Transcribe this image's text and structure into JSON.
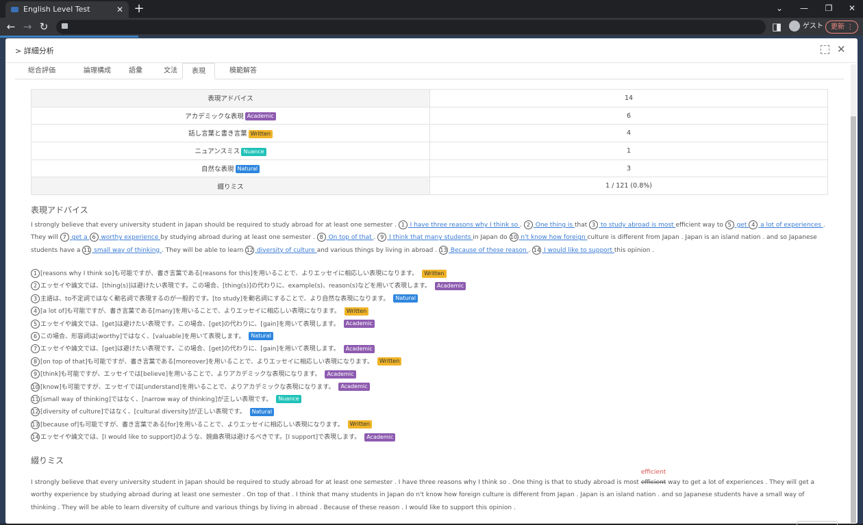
{
  "browser": {
    "tab_title": "English Level Test",
    "guest_label": "ゲスト",
    "update_label": "更新"
  },
  "modal": {
    "title": "詳細分析"
  },
  "tabs": [
    "総合評価",
    "論理構成",
    "語彙",
    "文法",
    "表現",
    "模範解答"
  ],
  "summary": [
    {
      "label": "表現アドバイス",
      "badge": "",
      "value": "14"
    },
    {
      "label": "アカデミックな表現",
      "badge": "Academic",
      "value": "6"
    },
    {
      "label": "話し言葉と書き言葉",
      "badge": "Written",
      "value": "4"
    },
    {
      "label": "ニュアンスミス",
      "badge": "Nuance",
      "value": "1"
    },
    {
      "label": "自然な表現",
      "badge": "Natural",
      "value": "3"
    },
    {
      "label": "綴りミス",
      "badge": "",
      "value": "1 / 121 (0.8%)"
    }
  ],
  "advice_heading": "表現アドバイス",
  "essay_segments": [
    {
      "t": "I strongly believe that every university student in Japan should be required to study abroad for at least one semester .  "
    },
    {
      "n": "1",
      "l": " I have three reasons why I think so "
    },
    {
      "t": " .  "
    },
    {
      "n": "2",
      "l": " One thing is "
    },
    {
      "t": "  that  "
    },
    {
      "n": "3",
      "l": " to study abroad is most "
    },
    {
      "t": "  efficient way to  "
    },
    {
      "n": "5",
      "l": " get "
    },
    {
      "t": " "
    },
    {
      "n": "4",
      "l": " a lot of experiences "
    },
    {
      "t": "  . They will  "
    },
    {
      "n": "7",
      "l": " get a "
    },
    {
      "t": " "
    },
    {
      "n": "6",
      "l": " worthy experience "
    },
    {
      "t": "  by studying abroad during at least one semester .  "
    },
    {
      "n": "8",
      "l": " On top of that "
    },
    {
      "t": " .  "
    },
    {
      "n": "9",
      "l": " I think that many students "
    },
    {
      "t": "  in Japan do  "
    },
    {
      "n": "10",
      "l": " n't know how foreign "
    },
    {
      "t": "  culture is different from Japan . Japan is an island nation . and so Japanese students have a  "
    },
    {
      "n": "11",
      "l": " small way of thinking "
    },
    {
      "t": "  . They will be able to learn  "
    },
    {
      "n": "12",
      "l": " diversity of culture "
    },
    {
      "t": "  and various things by living in abroad .  "
    },
    {
      "n": "13",
      "l": " Because of these reason "
    },
    {
      "t": " .  "
    },
    {
      "n": "14",
      "l": " I would like to support "
    },
    {
      "t": "  this opinion ."
    }
  ],
  "advice": [
    {
      "n": "1",
      "text": "[reasons why I think so]も可能ですが、書き言葉である[reasons for this]を用いることで、よりエッセイに相応しい表現になります。",
      "badge": "Written"
    },
    {
      "n": "2",
      "text": "エッセイや論文では、[thing(s)]は避けたい表現です。この場合、[thing(s)]の代わりに、example(s)、reason(s)などを用いて表現します。",
      "badge": "Academic"
    },
    {
      "n": "3",
      "text": "主語は、to不定詞ではなく動名詞で表現するのが一般的です。[to study]を動名詞にすることで、より自然な表現になります。",
      "badge": "Natural"
    },
    {
      "n": "4",
      "text": "[a lot of]も可能ですが、書き言葉である[many]を用いることで、よりエッセイに相応しい表現になります。",
      "badge": "Written"
    },
    {
      "n": "5",
      "text": "エッセイや論文では、[get]は避けたい表現です。この場合、[get]の代わりに、[gain]を用いて表現します。",
      "badge": "Academic"
    },
    {
      "n": "6",
      "text": "この場合、形容詞は[worthy]ではなく、[valuable]を用いて表現します。",
      "badge": "Natural"
    },
    {
      "n": "7",
      "text": "エッセイや論文では、[get]は避けたい表現です。この場合、[get]の代わりに、[gain]を用いて表現します。",
      "badge": "Academic"
    },
    {
      "n": "8",
      "text": "[on top of that]も可能ですが、書き言葉である[moreover]を用いることで、よりエッセイに相応しい表現になります。",
      "badge": "Written"
    },
    {
      "n": "9",
      "text": "[think]も可能ですが、エッセイでは[believe]を用いることで、よりアカデミックな表現になります。",
      "badge": "Academic"
    },
    {
      "n": "10",
      "text": "[know]も可能ですが、エッセイでは[understand]を用いることで、よりアカデミックな表現になります。",
      "badge": "Academic"
    },
    {
      "n": "11",
      "text": "[small way of thinking]ではなく、[narrow way of thinking]が正しい表現です。",
      "badge": "Nuance"
    },
    {
      "n": "12",
      "text": "[diversity of culture]ではなく、[cultural diversity]が正しい表現です。",
      "badge": "Natural"
    },
    {
      "n": "13",
      "text": "[because of]も可能ですが、書き言葉である[for]を用いることで、よりエッセイに相応しい表現になります。",
      "badge": "Written"
    },
    {
      "n": "14",
      "text": "エッセイや論文では、[I would like to support]のような、婉曲表現は避けるべきです。[I support]で表現します。",
      "badge": "Academic"
    }
  ],
  "spelling_heading": "綴りミス",
  "spelling": {
    "before": "I strongly believe that every university student in Japan should be required to study abroad for at least one semester . I have three reasons why I think so . One thing is that to study abroad is most ",
    "wrong": "efficient",
    "correction": "efficient",
    "after": " way to get a lot of experiences . They will get a worthy experience by studying abroad during at least one semester . On top of that . I think that many students in Japan do n't know how foreign culture is different from Japan . Japan is an island nation . and so Japanese students have a small way of thinking . They will be able to learn diversity of culture and various things by living in abroad . Because of these reason . I would like to support this opinion ."
  }
}
